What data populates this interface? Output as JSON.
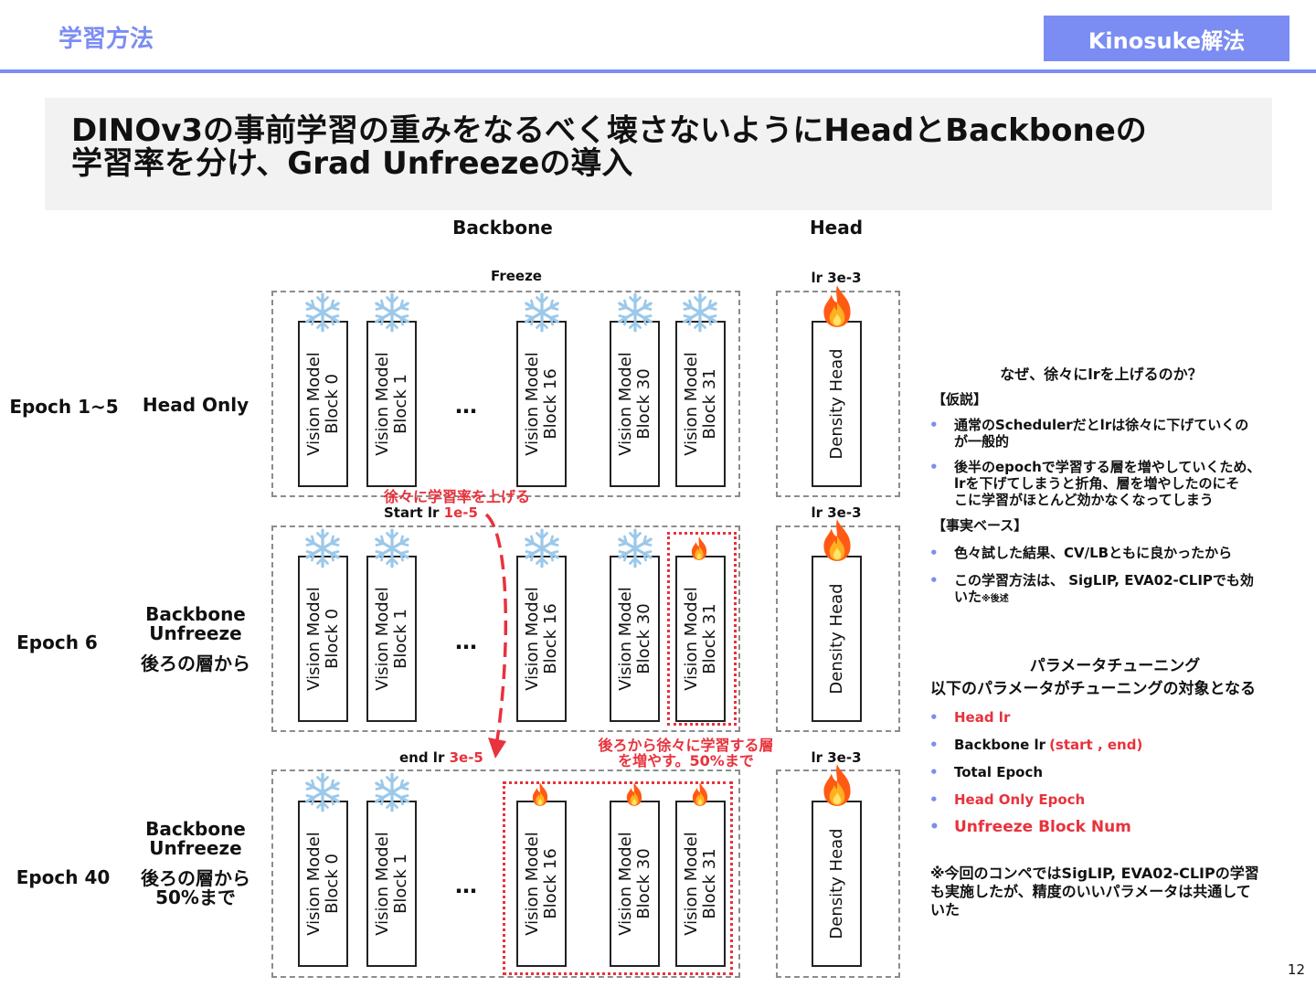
{
  "header": {
    "section_title": "学習方法",
    "badge": "Kinosuke解法",
    "headline_line1": "DINOv3の事前学習の重みをなるべく壊さないようにHeadとBackboneの",
    "headline_line2": "学習率を分け、Grad Unfreezeの導入"
  },
  "columns": {
    "backbone": "Backbone",
    "head": "Head"
  },
  "labels": {
    "freeze": "Freeze",
    "lr_head": "lr 3e-3",
    "ellipsis": "…",
    "start_lr_prefix": "Start lr ",
    "start_lr_value": "1e-5",
    "end_lr_prefix": "end lr ",
    "end_lr_value": "3e-5",
    "annot_increase_lr": "徐々に学習率を上げる",
    "annot_increase_layers_1": "後ろから徐々に学習する層",
    "annot_increase_layers_2": "を増やす。50%まで"
  },
  "blocks": {
    "line1": "Vision Model",
    "b0": "Block 0",
    "b1": "Block 1",
    "b16": "Block 16",
    "b30": "Block 30",
    "b31": "Block 31",
    "head": "Density Head"
  },
  "rows": [
    {
      "epoch": "Epoch 1~5",
      "desc1": "Head Only",
      "desc2": "",
      "desc3": ""
    },
    {
      "epoch": "Epoch 6",
      "desc1": "Backbone",
      "desc2": "Unfreeze",
      "desc3": "後ろの層から"
    },
    {
      "epoch": "Epoch 40",
      "desc1": "Backbone",
      "desc2": "Unfreeze",
      "desc3": "後ろの層から",
      "desc4": "50%まで"
    }
  ],
  "right_panel": {
    "why_title": "なぜ、徐々にlrを上げるのか？",
    "hypothesis_label": "【仮説】",
    "hypothesis_items": [
      "通常のSchedulerだとlrは徐々に下げていくの",
      "が一般的",
      "後半のepochで学習する層を増やしていくため、",
      "lrを下げてしまうと折角、層を増やしたのにそ",
      "こに学習がほとんど効かなくなってしまう"
    ],
    "fact_label": "【事実ベース】",
    "fact_items": [
      "色々試した結果、CV/LBともに良かったから",
      "この学習方法は、 SigLIP, EVA02-CLIPでも効",
      "いた",
      "※後述"
    ],
    "tuning_title": "パラメータチューニング",
    "tuning_intro": "以下のパラメータがチューニングの対象となる",
    "tuning_items": [
      "Head lr",
      "Backbone lr ",
      "(start , end)",
      "Total Epoch",
      "Head Only Epoch",
      "Unfreeze Block Num"
    ],
    "note_lines": [
      "※今回のコンペではSigLIP, EVA02-CLIPの学習",
      "も実施したが、精度のいいパラメータは共通して",
      "いた"
    ]
  },
  "bullet_glyph": "•",
  "page_number": "12",
  "colors": {
    "accent": "#7b8df2",
    "red": "#e8323c",
    "snow": "#9cc9ea",
    "fire": "#ff6a13"
  },
  "icons": {
    "frozen": "snowflake-icon",
    "training": "fire-icon"
  }
}
